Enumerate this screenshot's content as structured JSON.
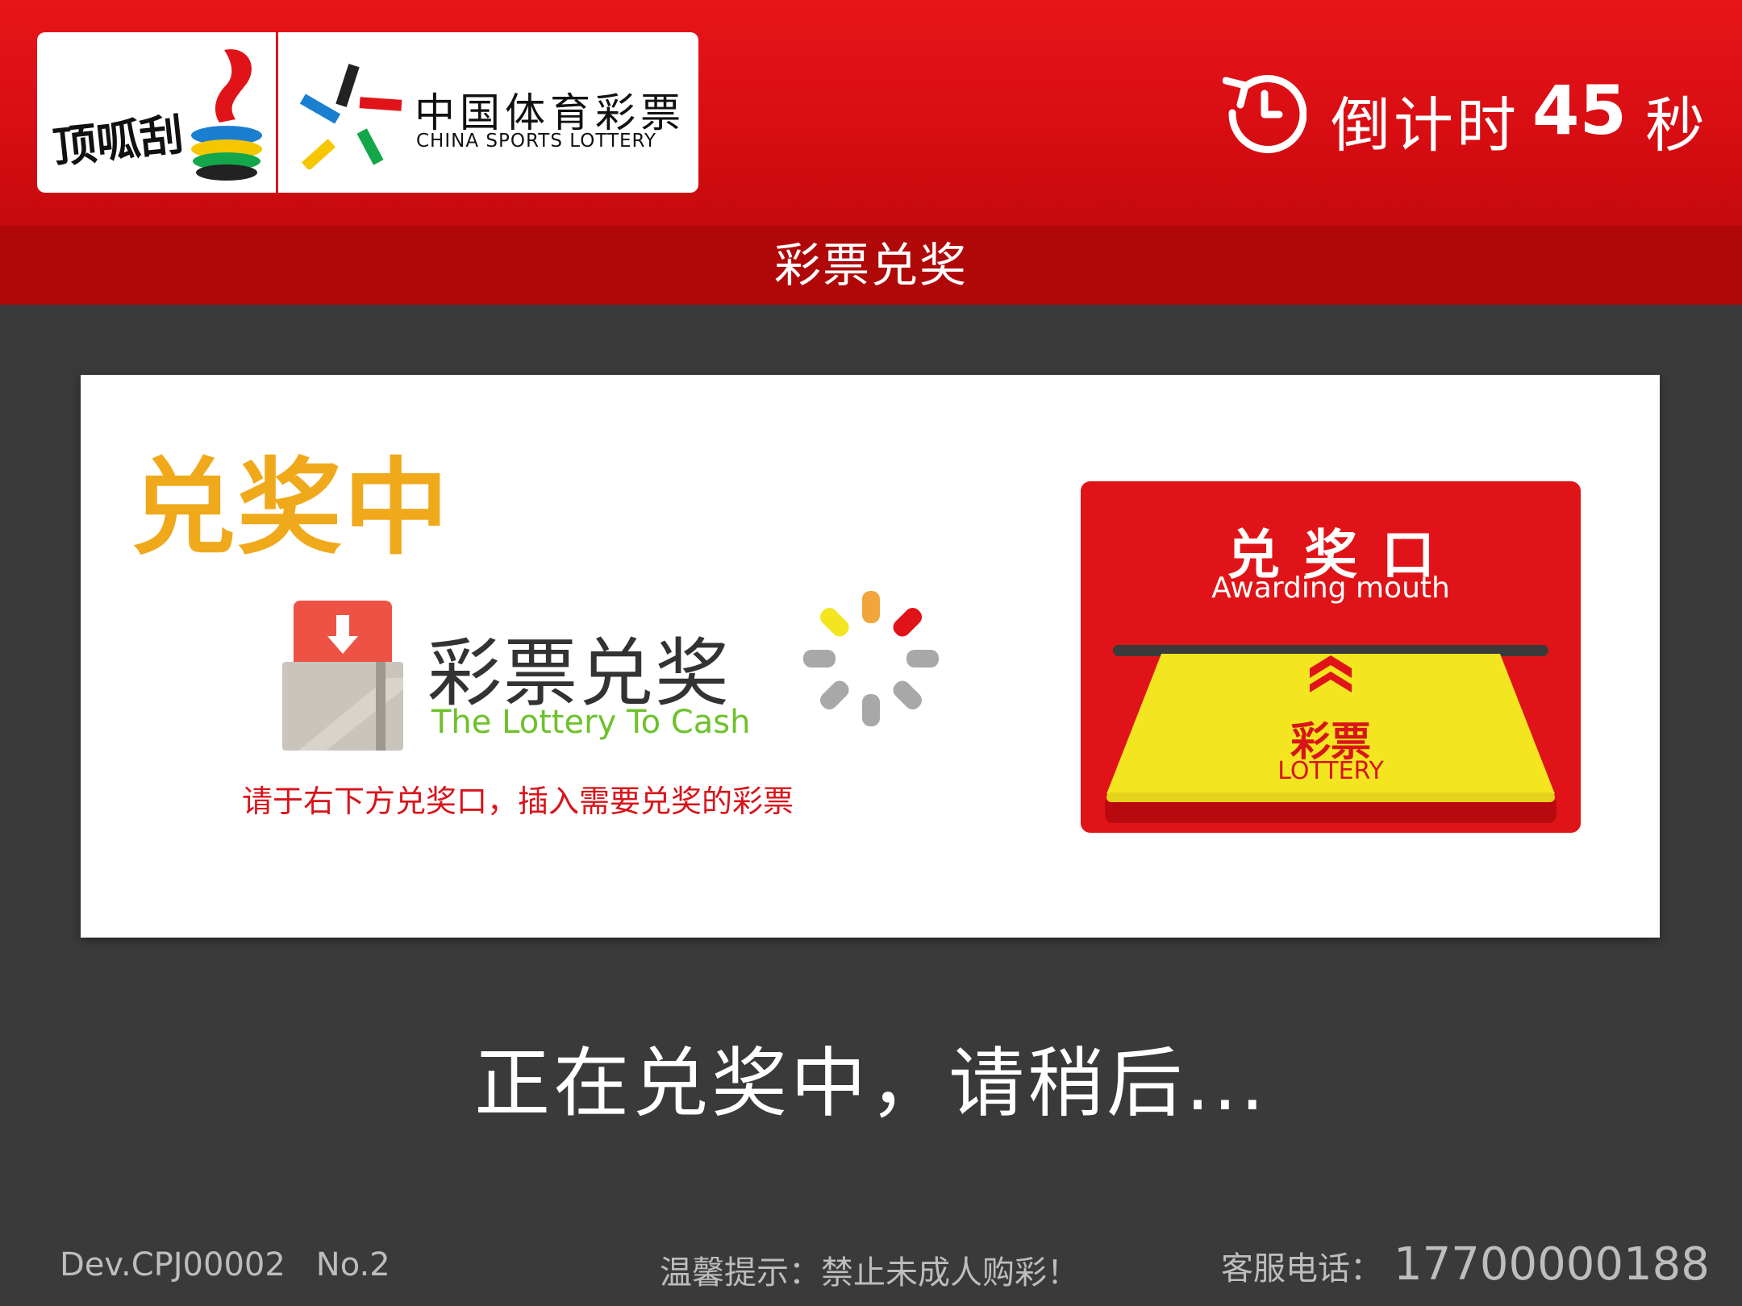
{
  "header": {
    "brand_left_text": "顶呱刮",
    "brand_right_cn": "中国体育彩票",
    "brand_right_en": "CHINA SPORTS LOTTERY",
    "countdown_label": "倒计时",
    "countdown_value": "45",
    "countdown_unit": "秒"
  },
  "title": "彩票兑奖",
  "panel": {
    "heading": "兑奖中",
    "cash_title": "彩票兑奖",
    "cash_subtitle": "The Lottery To Cash",
    "instruction": "请于右下方兑奖口，插入需要兑奖的彩票",
    "slot_title": "兑奖口",
    "slot_subtitle": "Awarding mouth",
    "ticket_cn": "彩票",
    "ticket_en": "LOTTERY"
  },
  "message": "正在兑奖中，请稍后...",
  "footer": {
    "device": "Dev.CPJ00002",
    "number": "No.2",
    "notice": "温馨提示：禁止未成人购彩！",
    "hotline_label": "客服电话：",
    "hotline_number": "17700000188"
  },
  "colors": {
    "brand_red": "#e01418",
    "title_bar_red": "#b00808",
    "heading_orange": "#f0a91b",
    "subtitle_green": "#6ec12c",
    "ticket_yellow": "#f3e51f",
    "background": "#3a3a3a"
  }
}
